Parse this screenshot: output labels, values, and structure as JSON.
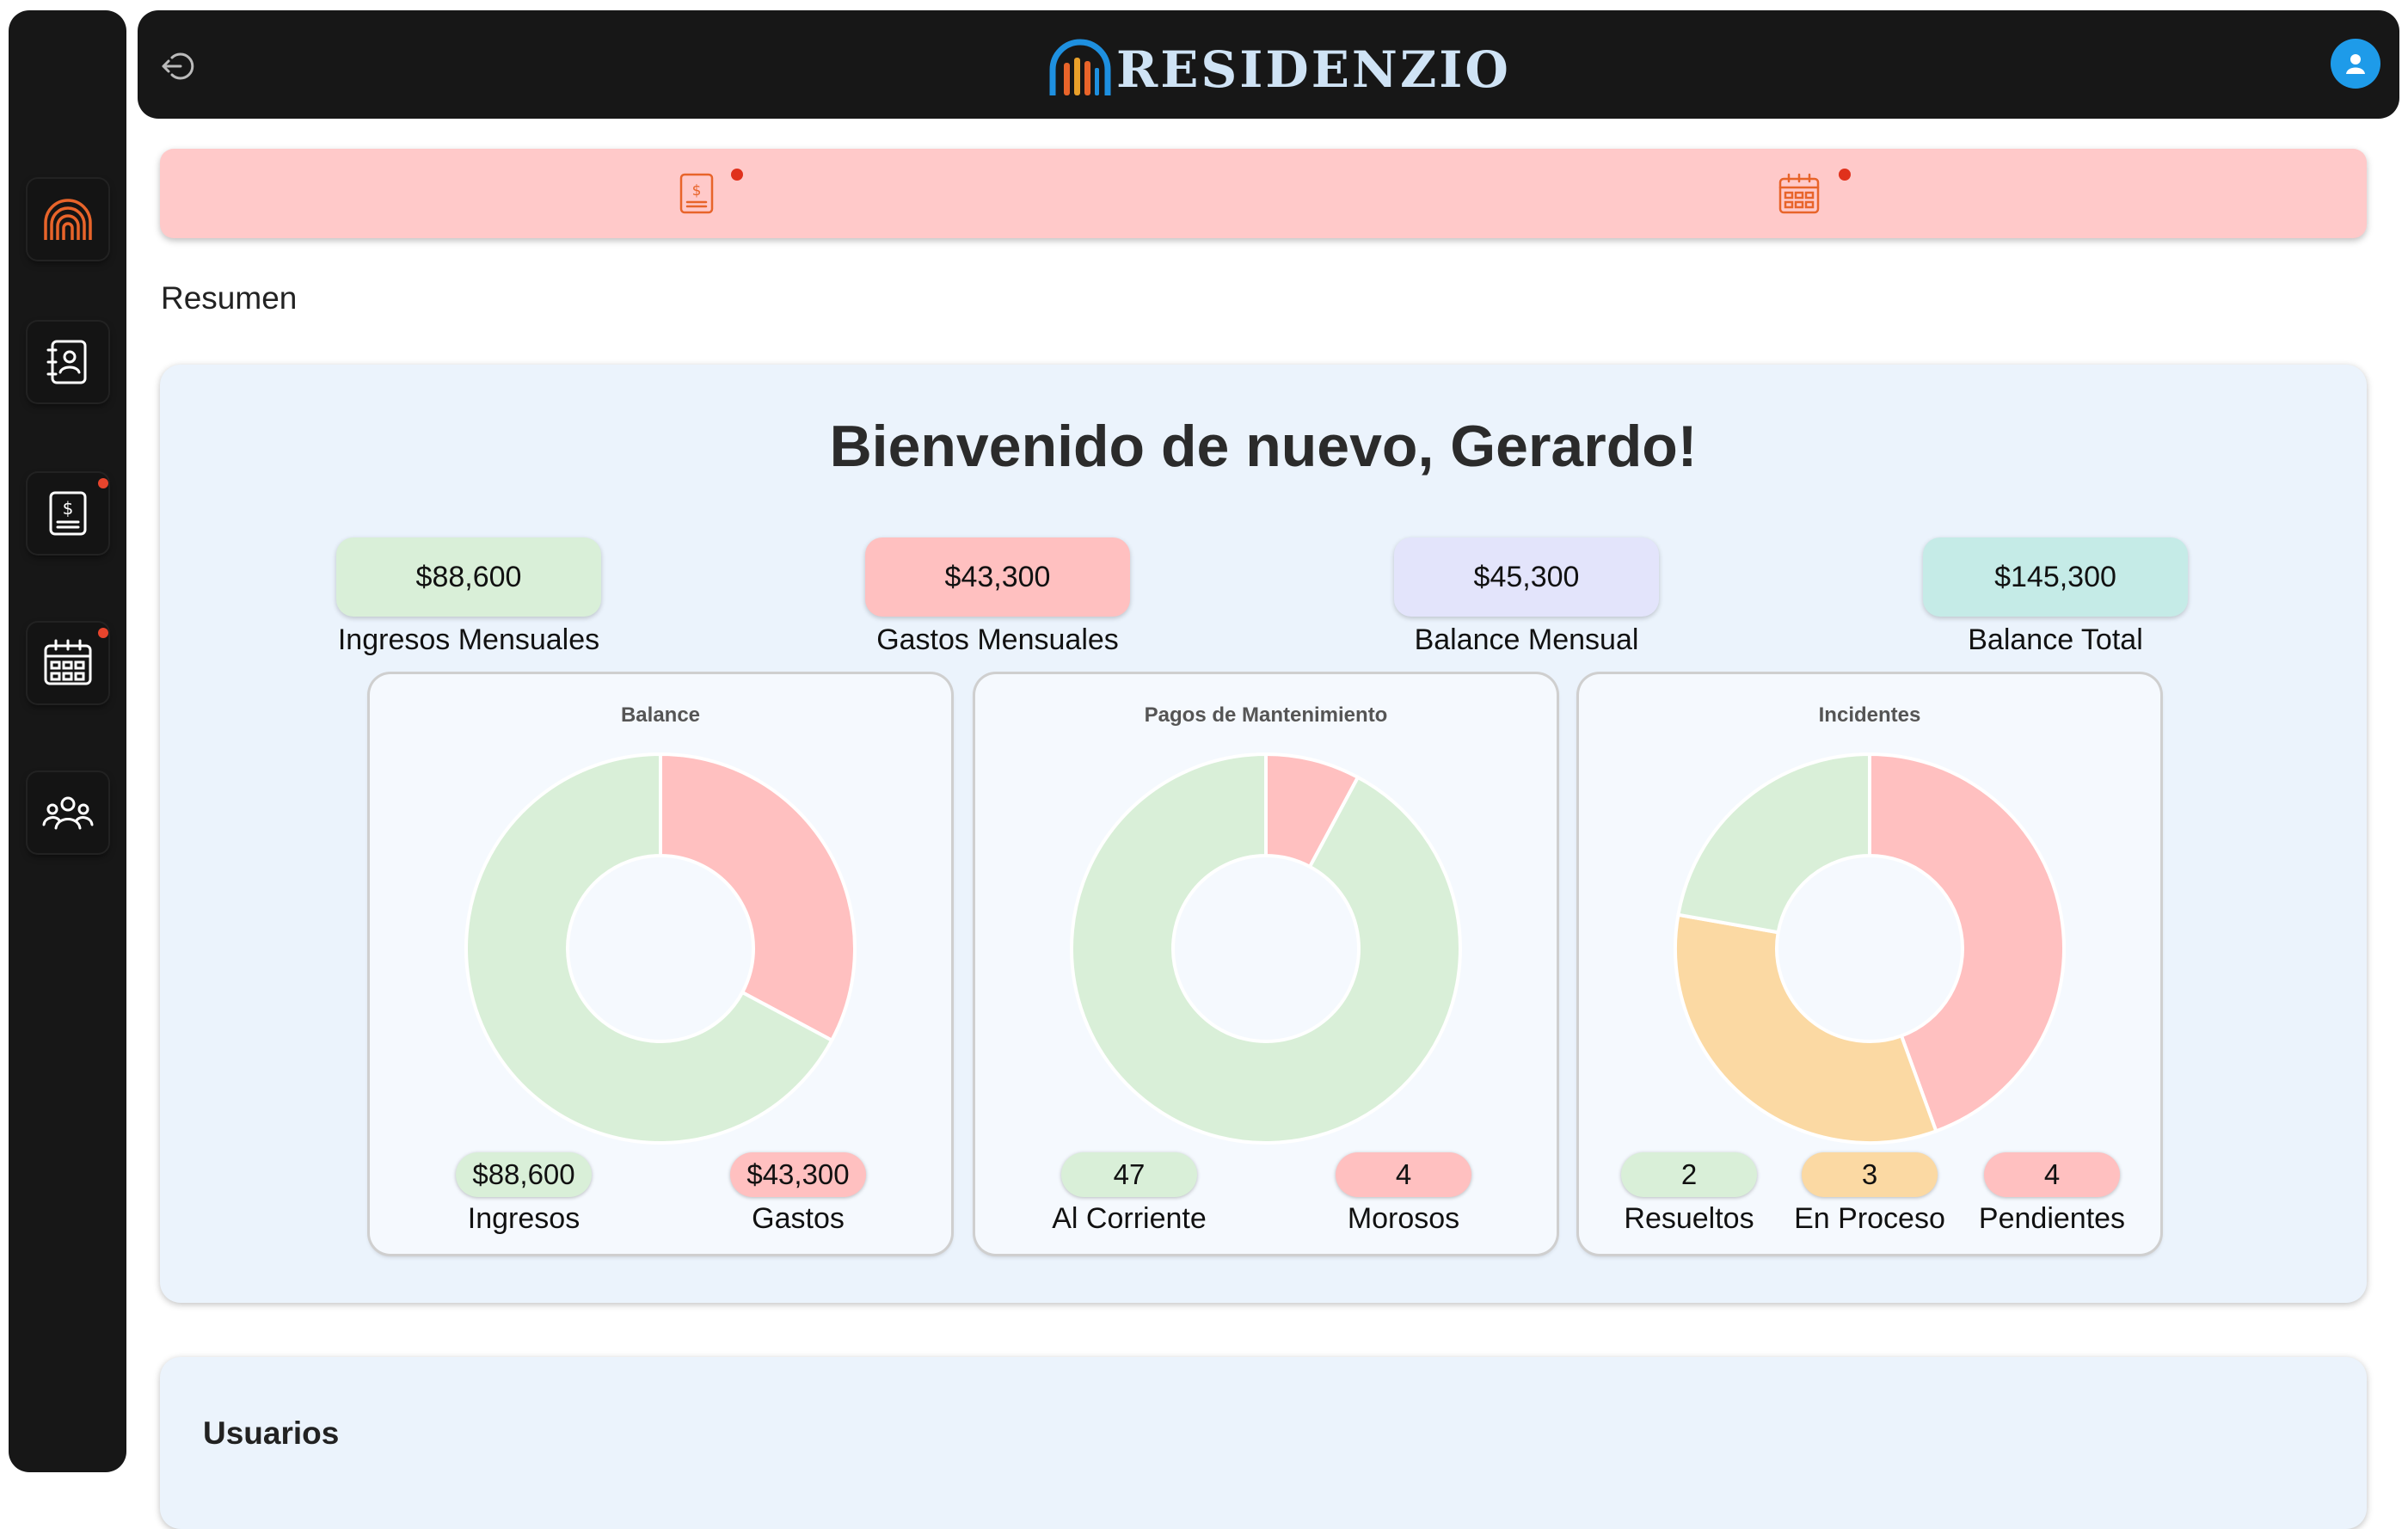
{
  "app": {
    "name": "RESIDENZIO"
  },
  "icons": {
    "logout": "logout-icon",
    "user": "user-icon",
    "sidebar": [
      "residenzio-logo-icon",
      "contacts-icon",
      "bill-icon",
      "calendar-icon",
      "community-icon"
    ],
    "alerts": [
      "bill-icon",
      "calendar-icon"
    ]
  },
  "colors": {
    "accent": "#e8642a",
    "ingresos": "#d9efd8",
    "gastos": "#ffc0c0",
    "balance_mensual": "#e3e4fb",
    "balance_total": "#c5ebe7",
    "en_proceso": "#fbd9a3",
    "notification": "#e0311c"
  },
  "section": {
    "title": "Resumen"
  },
  "welcome": "Bienvenido de nuevo, Gerardo!",
  "stats": [
    {
      "value": "$88,600",
      "label": "Ingresos Mensuales"
    },
    {
      "value": "$43,300",
      "label": "Gastos Mensuales"
    },
    {
      "value": "$45,300",
      "label": "Balance Mensual"
    },
    {
      "value": "$145,300",
      "label": "Balance Total"
    }
  ],
  "chart_data": [
    {
      "type": "pie",
      "title": "Balance",
      "categories": [
        "Ingresos",
        "Gastos"
      ],
      "values": [
        88600,
        43300
      ],
      "value_labels": [
        "$88,600",
        "$43,300"
      ],
      "colors": [
        "#d9efd8",
        "#ffc0c0"
      ]
    },
    {
      "type": "pie",
      "title": "Pagos de Mantenimiento",
      "categories": [
        "Al Corriente",
        "Morosos"
      ],
      "values": [
        47,
        4
      ],
      "value_labels": [
        "47",
        "4"
      ],
      "colors": [
        "#d9efd8",
        "#ffc0c0"
      ]
    },
    {
      "type": "pie",
      "title": "Incidentes",
      "categories": [
        "Resueltos",
        "En Proceso",
        "Pendientes"
      ],
      "values": [
        2,
        3,
        4
      ],
      "value_labels": [
        "2",
        "3",
        "4"
      ],
      "colors": [
        "#d9efd8",
        "#fbd9a3",
        "#ffc0c0"
      ]
    }
  ],
  "users": {
    "title": "Usuarios"
  }
}
